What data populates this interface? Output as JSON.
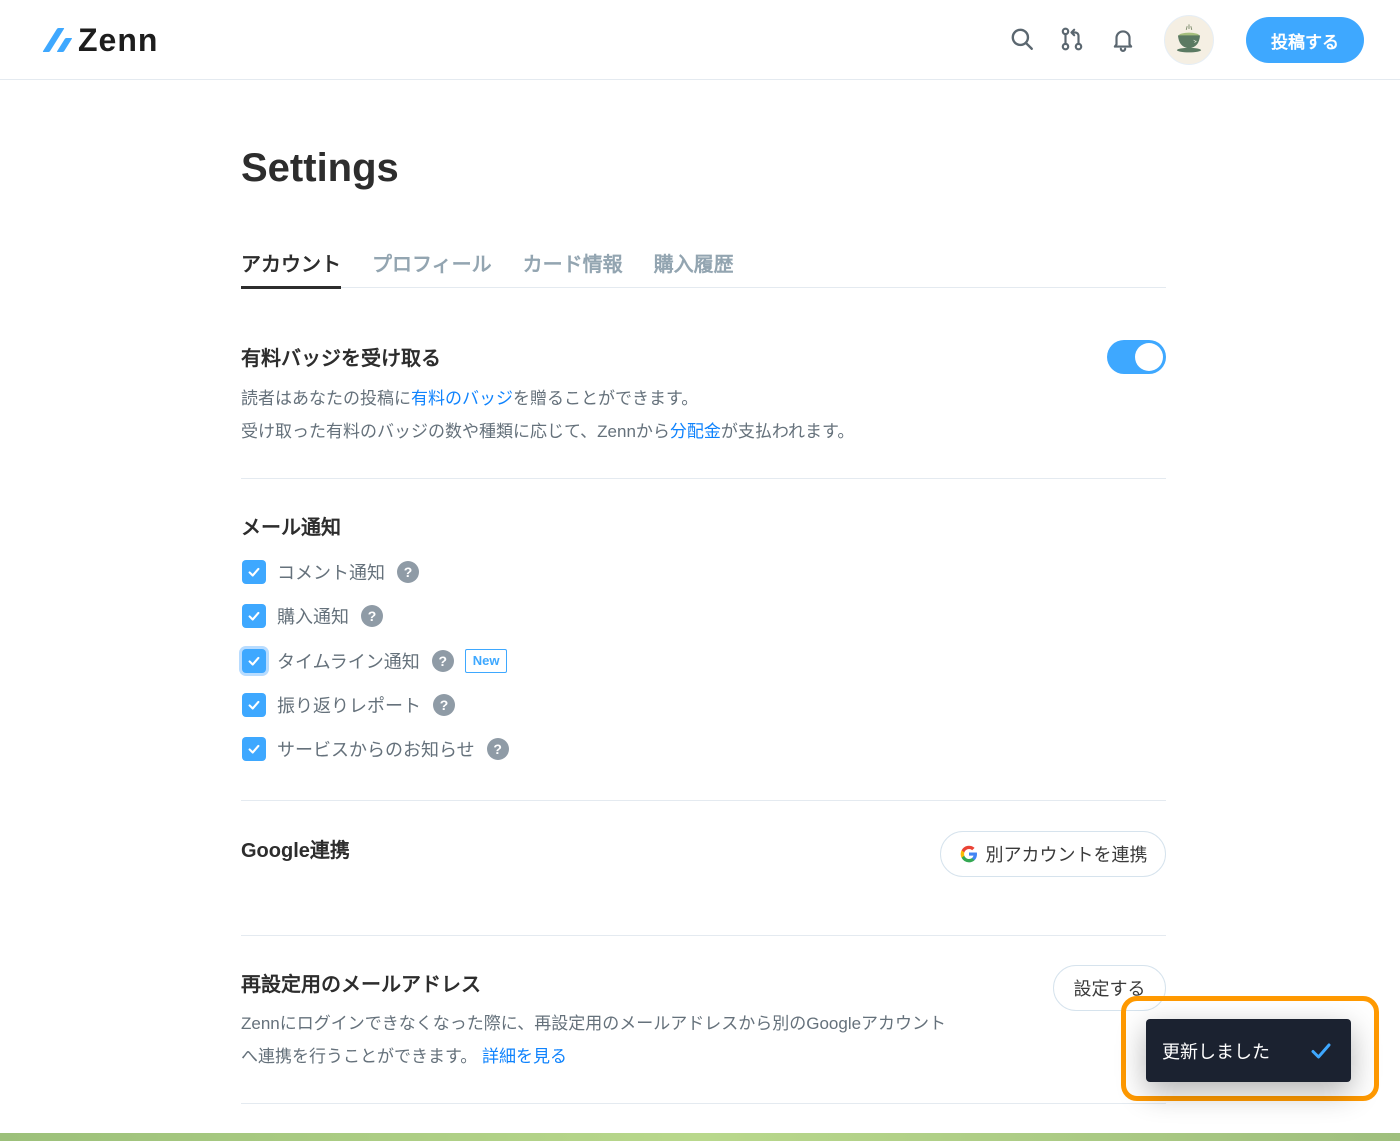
{
  "header": {
    "logo_text": "Zenn",
    "icons": [
      "search-icon",
      "pull-request-icon",
      "bell-icon"
    ],
    "post_button": "投稿する"
  },
  "page": {
    "title": "Settings",
    "tabs": [
      {
        "label": "アカウント",
        "active": true
      },
      {
        "label": "プロフィール",
        "active": false
      },
      {
        "label": "カード情報",
        "active": false
      },
      {
        "label": "購入履歴",
        "active": false
      }
    ]
  },
  "badge_section": {
    "title": "有料バッジを受け取る",
    "toggle_on": true,
    "line1_pre": "読者はあなたの投稿に",
    "line1_link": "有料のバッジ",
    "line1_post": "を贈ることができます。",
    "line2_pre": "受け取った有料のバッジの数や種類に応じて、Zennから",
    "line2_link": "分配金",
    "line2_post": "が支払われます。"
  },
  "mail_section": {
    "title": "メール通知",
    "items": [
      {
        "label": "コメント通知",
        "checked": true
      },
      {
        "label": "購入通知",
        "checked": true
      },
      {
        "label": "タイムライン通知",
        "checked": true,
        "badge": "New"
      },
      {
        "label": "振り返りレポート",
        "checked": true
      },
      {
        "label": "サービスからのお知らせ",
        "checked": true
      }
    ],
    "help_glyph": "?"
  },
  "google_section": {
    "title": "Google連携",
    "button": "別アカウントを連携"
  },
  "reset_email_section": {
    "title": "再設定用のメールアドレス",
    "button": "設定する",
    "line1": "Zennにログインできなくなった際に、再設定用のメールアドレスから別のGoogleアカウント",
    "line2": "へ連携を行うことができます。",
    "link": "詳細を見る"
  },
  "toast": {
    "message": "更新しました",
    "icon": "check-icon",
    "check_color": "#3ea8ff"
  },
  "colors": {
    "accent": "#3ea8ff",
    "link": "#0f83fd",
    "highlight": "#ff9900"
  }
}
